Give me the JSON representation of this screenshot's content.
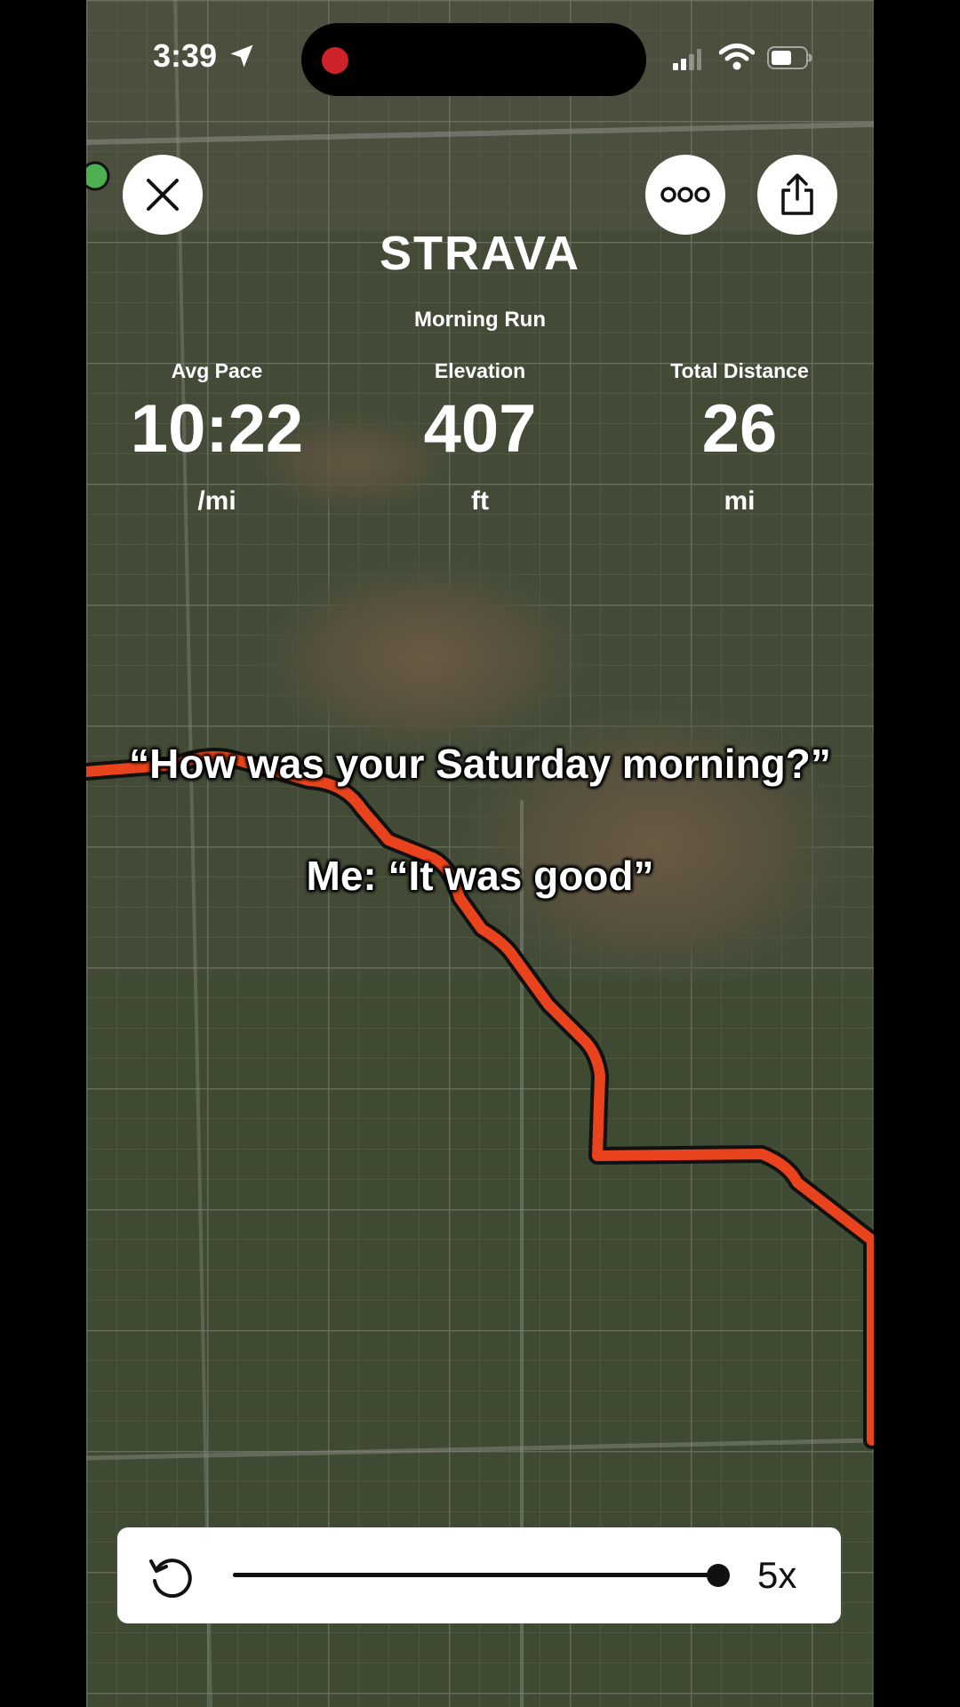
{
  "status_bar": {
    "time": "3:39"
  },
  "app": {
    "logo": "STRAVA",
    "activity_title": "Morning Run"
  },
  "stats": [
    {
      "label": "Avg Pace",
      "value": "10:22",
      "unit": "/mi"
    },
    {
      "label": "Elevation",
      "value": "407",
      "unit": "ft"
    },
    {
      "label": "Total Distance",
      "value": "26",
      "unit": "mi"
    }
  ],
  "caption": {
    "line1": "“How was your Saturday morning?”",
    "line2": "Me: “It was good”"
  },
  "player": {
    "speed_label": "5x",
    "progress": 1.0
  },
  "icons": {
    "close": "close-icon",
    "more": "more-icon",
    "share": "share-icon",
    "replay": "replay-icon",
    "location": "location-arrow-icon",
    "signal": "signal-icon",
    "wifi": "wifi-icon",
    "battery": "battery-icon"
  },
  "colors": {
    "route": "#e8431d",
    "map_green": "#3f4f34",
    "record_dot": "#d0222a"
  }
}
